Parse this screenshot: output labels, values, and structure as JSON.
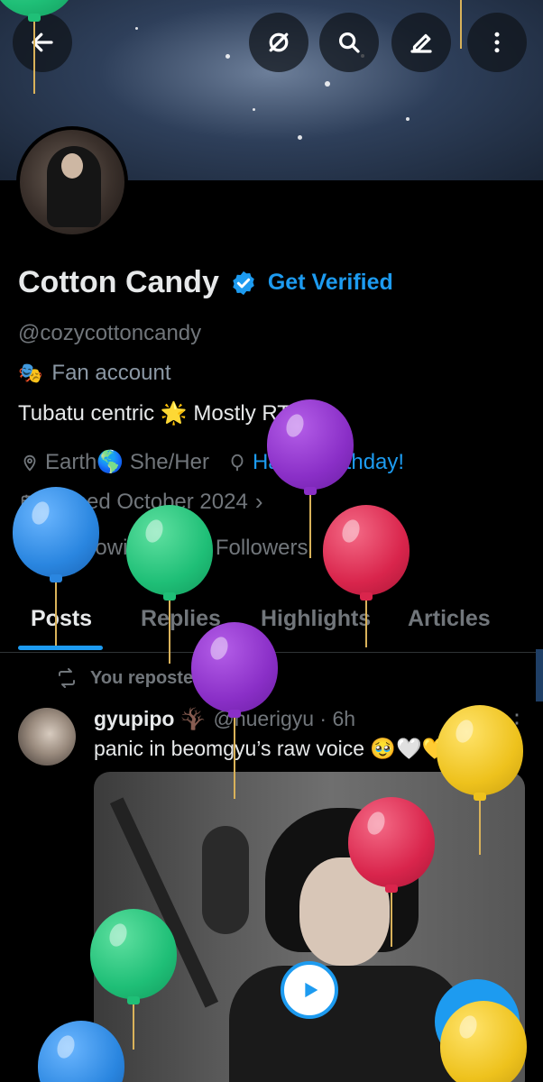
{
  "profile": {
    "display_name": "Cotton Candy",
    "get_verified": "Get Verified",
    "handle": "@cozycottoncandy",
    "category": "Fan account",
    "bio": "Tubatu centric 🌟 Mostly RT",
    "location": "Earth🌎 She/Her",
    "birthday_link": "Happy birthday!",
    "joined": "Joined October 2024",
    "following_count": "789",
    "following_label": "Following",
    "followers_count": "384",
    "followers_label": "Followers"
  },
  "tabs": [
    "Posts",
    "Replies",
    "Highlights",
    "Articles"
  ],
  "post": {
    "repost_label": "You reposted",
    "author": "gyupipo 🪾",
    "handle_time": "@huerigyu · 6h",
    "text": "panic in beomgyu’s raw voice 🥹🤍💛"
  },
  "icons": {
    "back": "back-arrow-icon",
    "grok": "grok-icon",
    "search": "search-icon",
    "edit": "edit-icon",
    "more": "more-vertical-icon",
    "fab": "plus-icon"
  },
  "colors": {
    "accent": "#1d9bf0",
    "background": "#000000",
    "muted": "#71767b"
  }
}
